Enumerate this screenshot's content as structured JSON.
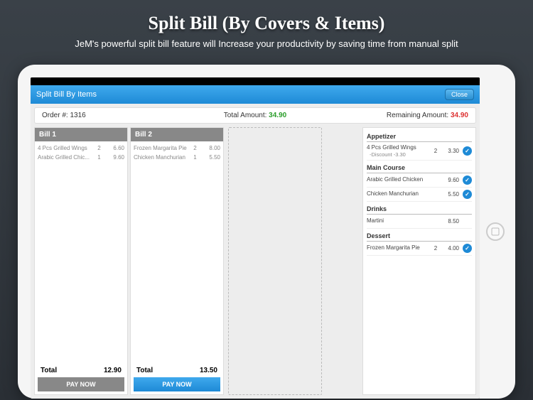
{
  "promo": {
    "title": "Split Bill (By Covers & Items)",
    "subtitle": "JeM's powerful split bill feature will Increase your productivity by saving time from manual split"
  },
  "header": {
    "title": "Split Bill By Items",
    "close_label": "Close"
  },
  "summary": {
    "order_label": "Order #:",
    "order_number": "1316",
    "total_label": "Total Amount:",
    "total_value": "34.90",
    "remaining_label": "Remaining Amount:",
    "remaining_value": "34.90"
  },
  "bills": [
    {
      "title": "Bill 1",
      "items": [
        {
          "name": "4 Pcs Grilled Wings",
          "qty": "2",
          "price": "6.60"
        },
        {
          "name": "Arabic Grilled Chic...",
          "qty": "1",
          "price": "9.60"
        }
      ],
      "total_label": "Total",
      "total_value": "12.90",
      "pay_label": "PAY NOW",
      "active": false
    },
    {
      "title": "Bill 2",
      "items": [
        {
          "name": "Frozen Margarita Pie",
          "qty": "2",
          "price": "8.00"
        },
        {
          "name": "Chicken Manchurian",
          "qty": "1",
          "price": "5.50"
        }
      ],
      "total_label": "Total",
      "total_value": "13.50",
      "pay_label": "PAY NOW",
      "active": true
    }
  ],
  "categories": [
    {
      "name": "Appetizer",
      "items": [
        {
          "name": "4 Pcs Grilled Wings",
          "sub": "-Discount   -3.30",
          "qty": "2",
          "price": "3.30",
          "checked": true
        }
      ]
    },
    {
      "name": "Main Course",
      "items": [
        {
          "name": "Arabic Grilled Chicken",
          "qty": "",
          "price": "9.60",
          "checked": true
        },
        {
          "name": "Chicken Manchurian",
          "qty": "",
          "price": "5.50",
          "checked": true
        }
      ]
    },
    {
      "name": "Drinks",
      "items": [
        {
          "name": "Martini",
          "qty": "",
          "price": "8.50",
          "checked": false
        }
      ]
    },
    {
      "name": "Dessert",
      "items": [
        {
          "name": "Frozen Margarita Pie",
          "qty": "2",
          "price": "4.00",
          "checked": true
        }
      ]
    }
  ]
}
